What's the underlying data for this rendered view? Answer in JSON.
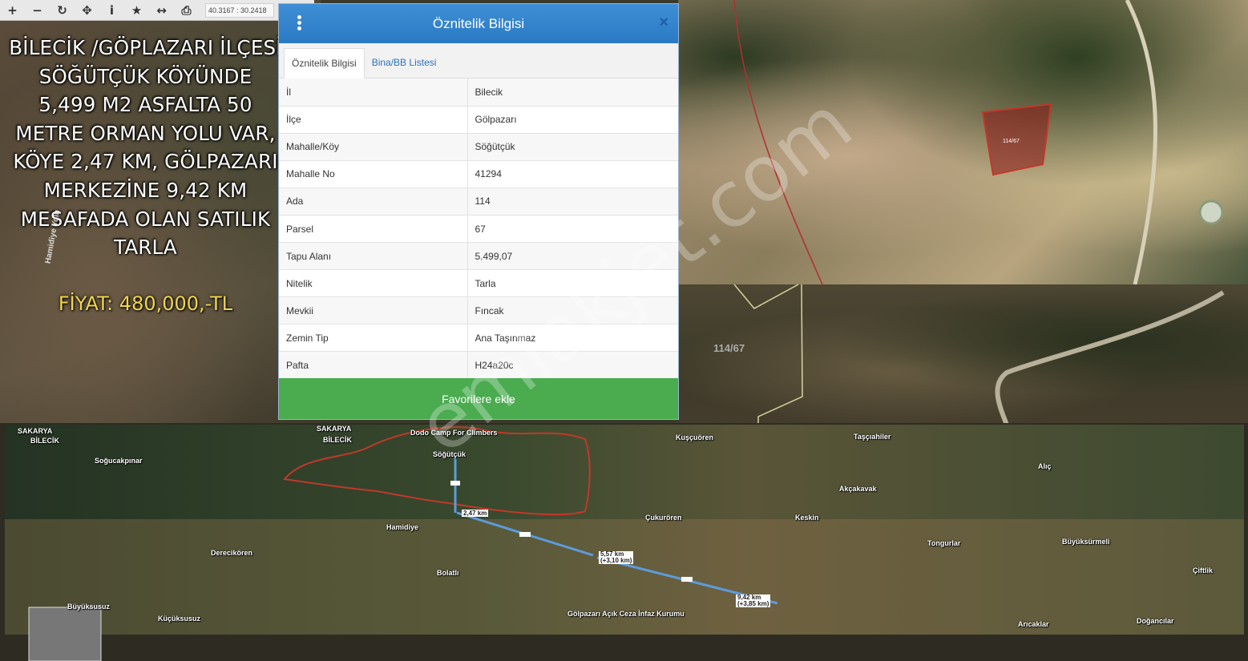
{
  "toolbar": {
    "coordinates": "40.3167 : 30.2418"
  },
  "listing": {
    "description": "BİLECİK /GÖPLAZARI İLÇESİ SÖĞÜTÇÜK KÖYÜNDE 5,499 M2 ASFALTA 50 METRE ORMAN YOLU VAR, KÖYE 2,47 KM, GÖLPAZARI MERKEZİNE 9,42 KM MESAFADA OLAN SATILIK TARLA",
    "price": "FİYAT: 480,000,-TL"
  },
  "panel": {
    "title": "Öznitelik Bilgisi",
    "tabs": [
      {
        "label": "Öznitelik Bilgisi",
        "active": true
      },
      {
        "label": "Bina/BB Listesi",
        "active": false
      }
    ],
    "rows": [
      {
        "key": "İl",
        "value": "Bilecik"
      },
      {
        "key": "İlçe",
        "value": "Gölpazarı"
      },
      {
        "key": "Mahalle/Köy",
        "value": "Söğütçük"
      },
      {
        "key": "Mahalle No",
        "value": "41294"
      },
      {
        "key": "Ada",
        "value": "114"
      },
      {
        "key": "Parsel",
        "value": "67"
      },
      {
        "key": "Tapu Alanı",
        "value": "5.499,07"
      },
      {
        "key": "Nitelik",
        "value": "Tarla"
      },
      {
        "key": "Mevkii",
        "value": "Fıncak"
      },
      {
        "key": "Zemin Tip",
        "value": "Ana Taşınmaz"
      },
      {
        "key": "Pafta",
        "value": "H24a20c"
      }
    ],
    "favorite_button": "Favorilere ekle"
  },
  "watermark": "emlakjet.com",
  "map": {
    "parcel_label": "114/67",
    "road_label": "Hamidiye Yolu",
    "places": [
      "SAKARYA",
      "BİLECİK",
      "Soğucakpınar",
      "SAKARYA",
      "BİLECİK",
      "Dodo Camp For Climbers",
      "Söğütçük",
      "Kuşçuören",
      "Taşçıahiler",
      "Alıç",
      "Akçakavak",
      "Çukurören",
      "Keskin",
      "Hamidiye",
      "Derecikören",
      "Bolatlı",
      "Tongurlar",
      "Büyüksürmeli",
      "Çiftlik",
      "Büyüksusuz",
      "Küçüksusuz",
      "Gölpazarı Açık Ceza İnfaz Kurumu",
      "Arıcaklar",
      "Doğancılar"
    ],
    "distance_labels": [
      "2,47 km",
      "5,57 km\n(+3,10 km)",
      "9,42 km\n(+3,85 km)"
    ]
  },
  "colors": {
    "panel_header": "#2a79c4",
    "favorite_button": "#4aab4f",
    "price_text": "#f2d64a",
    "boundary_red": "#c0392b",
    "route_blue": "#5d9bdc"
  }
}
